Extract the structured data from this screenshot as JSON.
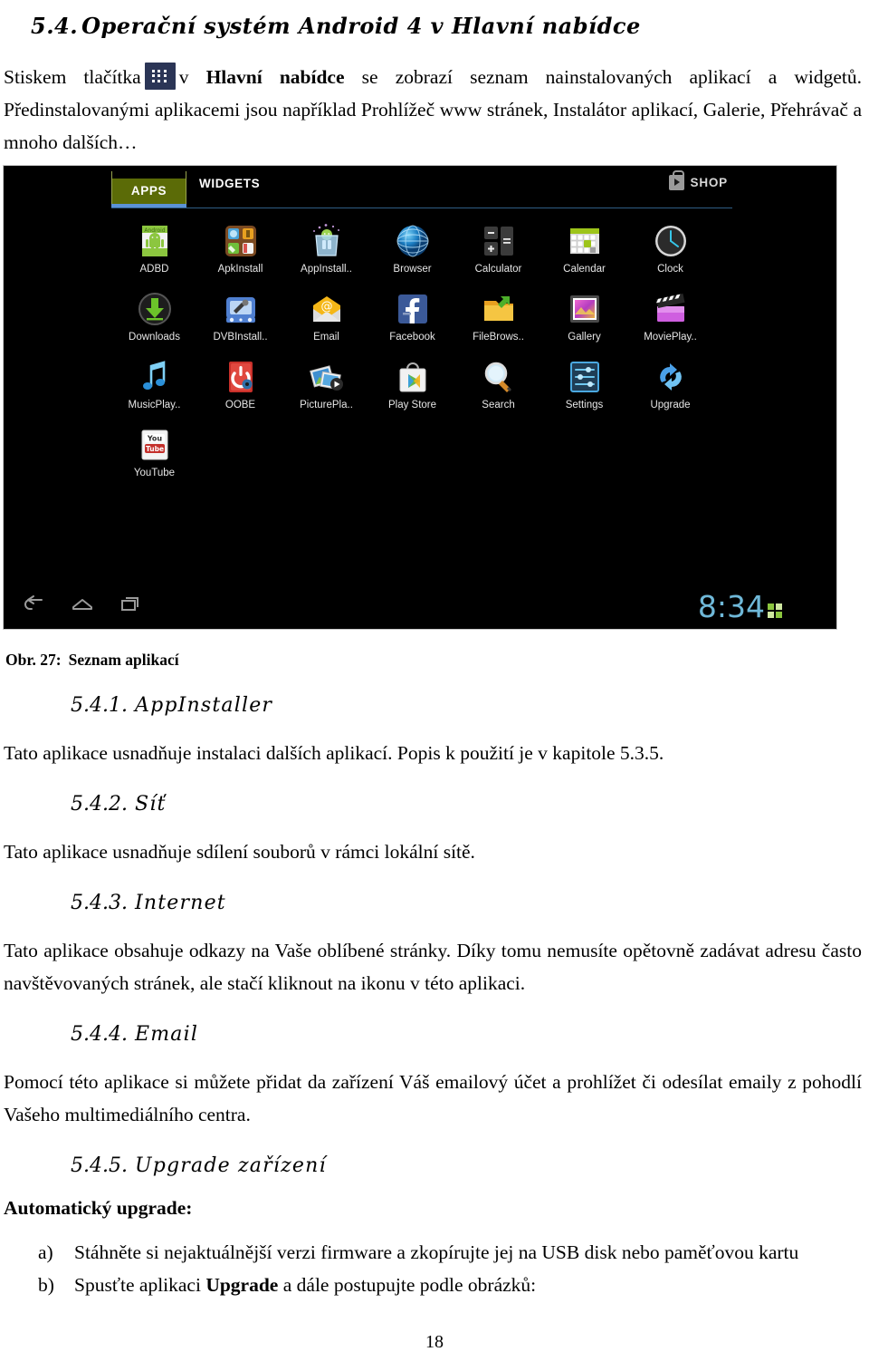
{
  "section": {
    "number": "5.4.",
    "title": "Operační systém Android 4 v Hlavní nabídce"
  },
  "intro": {
    "part1": "Stiskem tlačítka",
    "icon_name": "apps-grid-icon",
    "part2": "v",
    "bold1": "Hlavní nabídce",
    "part3": "se zobrazí seznam nainstalovaných aplikací a widgetů. Předinstalovanými aplikacemi jsou například Prohlížeč www stránek, Instalátor aplikací, Galerie, Přehrávač a mnoho dalších…"
  },
  "screenshot": {
    "tabs": {
      "apps": "APPS",
      "widgets": "WIDGETS"
    },
    "shop": "SHOP",
    "apps": [
      {
        "label": "ADBD",
        "icon": "android-adbd-icon"
      },
      {
        "label": "ApkInstall",
        "icon": "apk-install-icon"
      },
      {
        "label": "AppInstall..",
        "icon": "app-install-icon"
      },
      {
        "label": "Browser",
        "icon": "browser-globe-icon"
      },
      {
        "label": "Calculator",
        "icon": "calculator-icon"
      },
      {
        "label": "Calendar",
        "icon": "calendar-icon"
      },
      {
        "label": "Clock",
        "icon": "clock-icon"
      },
      {
        "label": "Downloads",
        "icon": "downloads-icon"
      },
      {
        "label": "DVBInstall..",
        "icon": "dvb-install-icon"
      },
      {
        "label": "Email",
        "icon": "email-envelope-icon"
      },
      {
        "label": "Facebook",
        "icon": "facebook-icon"
      },
      {
        "label": "FileBrows..",
        "icon": "file-browser-folder-icon"
      },
      {
        "label": "Gallery",
        "icon": "gallery-icon"
      },
      {
        "label": "MoviePlay..",
        "icon": "movie-player-icon"
      },
      {
        "label": "MusicPlay..",
        "icon": "music-player-icon"
      },
      {
        "label": "OOBE",
        "icon": "oobe-power-icon"
      },
      {
        "label": "PicturePla..",
        "icon": "picture-player-icon"
      },
      {
        "label": "Play Store",
        "icon": "play-store-icon"
      },
      {
        "label": "Search",
        "icon": "search-magnifier-icon"
      },
      {
        "label": "Settings",
        "icon": "settings-sliders-icon"
      },
      {
        "label": "Upgrade",
        "icon": "upgrade-refresh-icon"
      },
      {
        "label": "YouTube",
        "icon": "youtube-icon"
      }
    ],
    "navbar": {
      "back": "back-arrow-icon",
      "home": "home-icon",
      "recents": "recents-icon"
    },
    "status": {
      "time": "8:34",
      "signal_icon": "network-signal-icon"
    }
  },
  "caption": {
    "label": "Obr. 27:",
    "text": "Seznam aplikací"
  },
  "subsections": [
    {
      "number": "5.4.1.",
      "title": "AppInstaller",
      "body": "Tato aplikace usnadňuje instalaci dalších aplikací. Popis k použití je v kapitole 5.3.5."
    },
    {
      "number": "5.4.2.",
      "title": "Síť",
      "body": "Tato aplikace usnadňuje sdílení souborů v rámci lokální sítě."
    },
    {
      "number": "5.4.3.",
      "title": "Internet",
      "body": "Tato aplikace obsahuje odkazy na Vaše oblíbené stránky. Díky tomu nemusíte opětovně zadávat adresu často navštěvovaných stránek, ale stačí kliknout na ikonu v této aplikaci."
    },
    {
      "number": "5.4.4.",
      "title": "Email",
      "body": "Pomocí této aplikace si můžete přidat da zařízení Váš emailový účet a prohlížet či odesílat emaily z pohodlí Vašeho multimediálního centra."
    },
    {
      "number": "5.4.5.",
      "title": "Upgrade zařízení",
      "body": ""
    }
  ],
  "upgrade": {
    "lead": "Automatický upgrade:",
    "items": [
      {
        "marker": "a)",
        "text": "Stáhněte si nejaktuálnější verzi firmware a zkopírujte jej na USB disk nebo paměťovou kartu"
      },
      {
        "marker": "b)",
        "pre": "Spusťte aplikaci ",
        "bold": "Upgrade",
        "post": " a dále postupujte podle obrázků:"
      }
    ]
  },
  "page_number": "18",
  "colors": {
    "tab_active_bg": "#5b6b07",
    "tab_underline": "#5b92d6",
    "clock_blue": "#6fb8d8",
    "icon_navy": "#2b3556"
  }
}
